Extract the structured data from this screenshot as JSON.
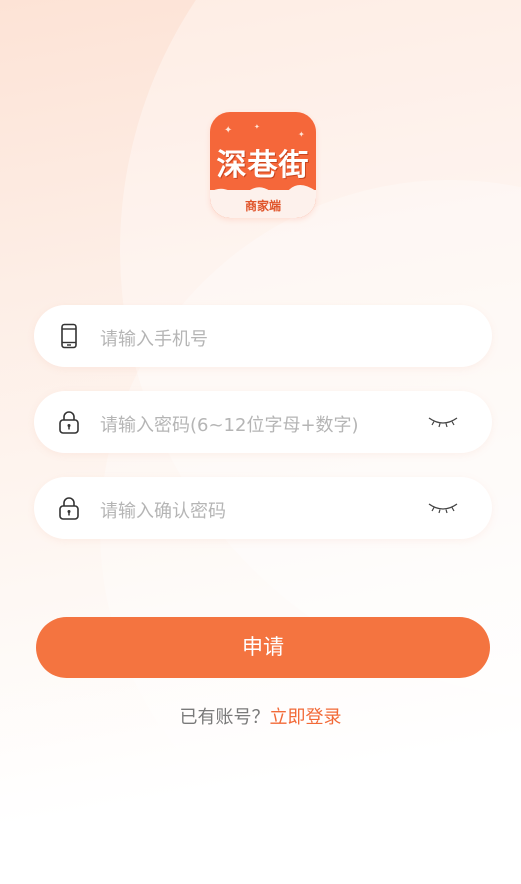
{
  "logo": {
    "title": "深巷街",
    "subtitle": "商家端",
    "color": "#f5673a"
  },
  "form": {
    "phone": {
      "placeholder": "请输入手机号",
      "icon": "phone-icon"
    },
    "password": {
      "placeholder": "请输入密码(6~12位字母+数字)",
      "icon": "lock-icon",
      "toggle_icon": "eye-closed-icon"
    },
    "confirm": {
      "placeholder": "请输入确认密码",
      "icon": "lock-icon",
      "toggle_icon": "eye-closed-icon"
    },
    "submit_label": "申请"
  },
  "footer": {
    "have_account": "已有账号？",
    "login_link": "立即登录"
  },
  "colors": {
    "accent": "#f47440",
    "link": "#f26a38",
    "placeholder": "#b5b5b5"
  }
}
